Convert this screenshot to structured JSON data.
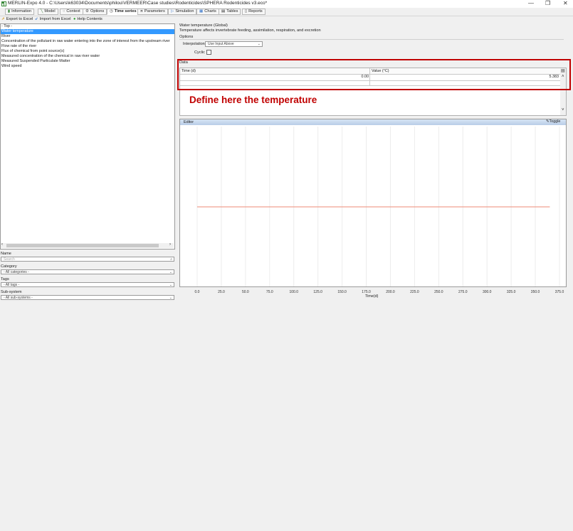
{
  "window": {
    "title": "MERLIN-Expo 4.0 - C:\\Users\\k63034\\Documents\\philou\\VERMEER\\Case studies\\Rodenticides\\SPHERA Rodenticides v3.eco*",
    "minimize_glyph": "—",
    "maximize_glyph": "❐",
    "close_glyph": "✕"
  },
  "tabs": [
    {
      "label": "Information",
      "icon": "info-icon"
    },
    {
      "label": "Model",
      "icon": "model-icon"
    },
    {
      "label": "Context",
      "icon": "context-icon"
    },
    {
      "label": "Options",
      "icon": "options-icon"
    },
    {
      "label": "Time series",
      "icon": "time-series-icon",
      "active": true
    },
    {
      "label": "Parameters",
      "icon": "pi-icon"
    },
    {
      "label": "Simulation",
      "icon": "play-icon"
    },
    {
      "label": "Charts",
      "icon": "chart-icon"
    },
    {
      "label": "Tables",
      "icon": "table-icon"
    },
    {
      "label": "Reports",
      "icon": "report-icon"
    }
  ],
  "toolbar": {
    "export_label": "Export to Excel",
    "import_label": "Import from Excel",
    "help_label": "Help Contents"
  },
  "tree": {
    "group_top": "- Top -",
    "top_items": [
      "Water temperature"
    ],
    "group_river": "River",
    "river_items": [
      "Concentration of the pollutant in raw water entering into the zone of interest from the upstream river",
      "Flow rate of the river",
      "Flux of chemical from point source(s)",
      "Measured concentration of the chemical in raw river water",
      "Measured Suspended Particulate Matter",
      "Wind speed"
    ]
  },
  "filters": {
    "name_label": "Name",
    "search_placeholder": "Search",
    "category_label": "Category",
    "category_value": "- All categories -",
    "tags_label": "Tags",
    "tags_value": "- All tags -",
    "subsystem_label": "Sub-system",
    "subsystem_value": "- All sub-systems -"
  },
  "detail": {
    "title": "Water temperature (Global)",
    "description": "Temperature affects invertebrate feeding, assimilation, respiration, and excretion",
    "options_label": "Options",
    "interpolation_label": "Interpolation",
    "interpolation_value": "Use Input Above",
    "cyclic_label": "Cyclic",
    "cyclic_checked": false,
    "data_label": "Data",
    "col_time": "Time (d)",
    "col_value": "Value (°C)",
    "rows": [
      {
        "time": "0.00",
        "value": "5.383"
      }
    ],
    "annotation": "Define here the temperature",
    "editor_label": "Editor",
    "toggle_label": "Toggle"
  },
  "chart_data": {
    "type": "line",
    "xlabel": "Time(d)",
    "xlim": [
      0,
      375
    ],
    "x_ticks": [
      "0.0",
      "25.0",
      "50.0",
      "75.0",
      "100.0",
      "125.0",
      "150.0",
      "175.0",
      "200.0",
      "225.0",
      "250.0",
      "275.0",
      "300.0",
      "325.0",
      "350.0",
      "375.0"
    ],
    "series": [
      {
        "x": [
          0,
          365
        ],
        "y": [
          5.383,
          5.383
        ],
        "color": "#f0a090"
      }
    ],
    "grid": true
  }
}
